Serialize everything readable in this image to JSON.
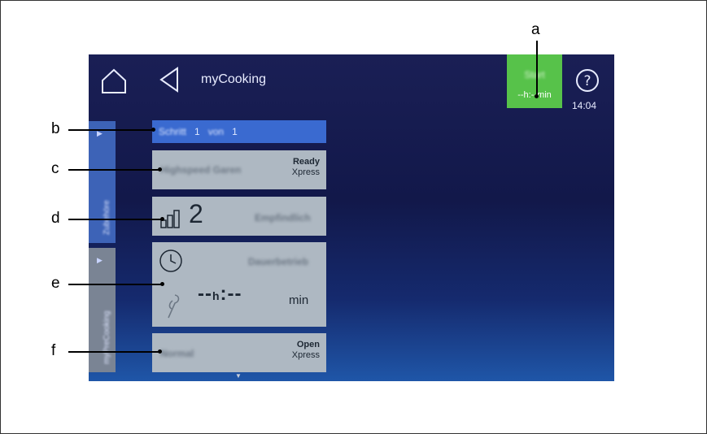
{
  "callouts": {
    "a": "a",
    "b": "b",
    "c": "c",
    "d": "d",
    "e": "e",
    "f": "f"
  },
  "header": {
    "title": "myCooking",
    "start_label": "Start",
    "start_time": "--h:--min",
    "clock": "14:04",
    "icons": [
      "home-icon",
      "back-arrow-icon",
      "help-icon"
    ]
  },
  "side_tabs": [
    {
      "label": "Zubehöre",
      "color": "#3d63b7"
    },
    {
      "label": "myPreCooking",
      "color": "#7a8494"
    }
  ],
  "steps": {
    "step_word": "Schritt",
    "current": "1",
    "of_word": "von",
    "total": "1"
  },
  "mode_panel": {
    "name": "Highspeed Garen",
    "badge_main": "Ready",
    "badge_sub": "Xpress"
  },
  "level_panel": {
    "value": "2",
    "label": "Empfindlich",
    "icon": "signal-bars-icon"
  },
  "time_panel": {
    "label": "Dauerbetrieb",
    "hours": "--",
    "h_unit": "h",
    "minutes": "--",
    "min_unit": "min",
    "icons": [
      "clock-icon",
      "probe-icon"
    ]
  },
  "door_panel": {
    "name": "Normal",
    "badge_main": "Open",
    "badge_sub": "Xpress"
  },
  "colors": {
    "start_green": "#57c24a",
    "step_blue": "#3a6ad0",
    "panel_grey": "#aeb8c2",
    "screen_dark": "#12184a",
    "screen_light": "#1f56a8"
  }
}
